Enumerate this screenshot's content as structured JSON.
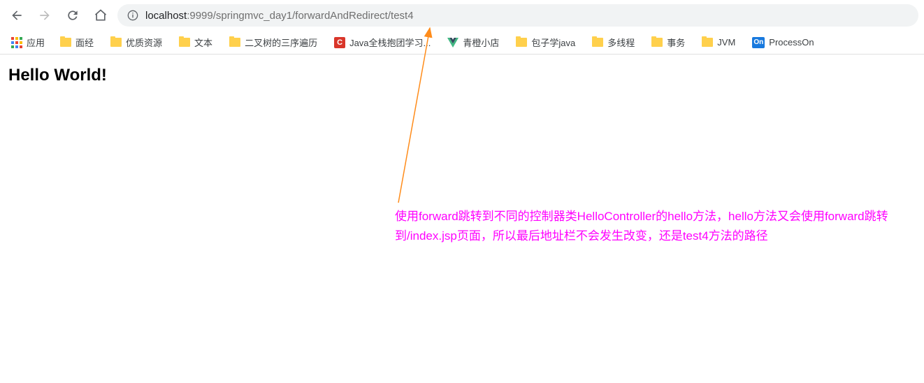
{
  "toolbar": {
    "url_host": "localhost",
    "url_rest": ":9999/springmvc_day1/forwardAndRedirect/test4"
  },
  "bookmarks": {
    "apps_label": "应用",
    "items": [
      {
        "label": "面经",
        "icon": "folder"
      },
      {
        "label": "优质资源",
        "icon": "folder"
      },
      {
        "label": "文本",
        "icon": "folder"
      },
      {
        "label": "二叉树的三序遍历",
        "icon": "folder"
      },
      {
        "label": "Java全栈抱团学习...",
        "icon": "c"
      },
      {
        "label": "青橙小店",
        "icon": "vue"
      },
      {
        "label": "包子学java",
        "icon": "folder"
      },
      {
        "label": "多线程",
        "icon": "folder"
      },
      {
        "label": "事务",
        "icon": "folder"
      },
      {
        "label": "JVM",
        "icon": "folder"
      },
      {
        "label": "ProcessOn",
        "icon": "on"
      }
    ]
  },
  "page": {
    "heading": "Hello World!"
  },
  "annotation": {
    "text": "使用forward跳转到不同的控制器类HelloController的hello方法，hello方法又会使用forward跳转到/index.jsp页面，所以最后地址栏不会发生改变，还是test4方法的路径"
  }
}
